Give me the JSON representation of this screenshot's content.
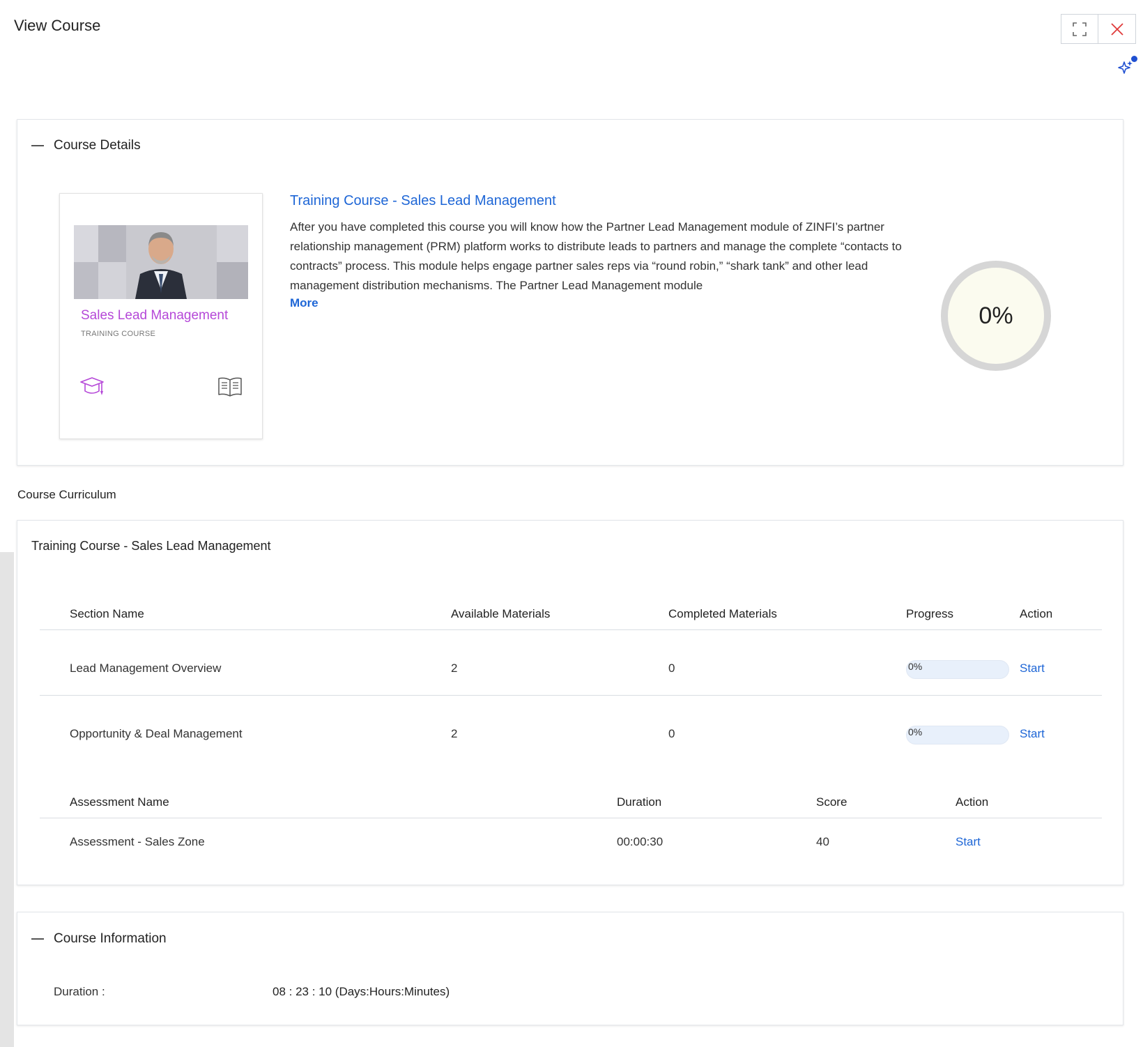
{
  "header": {
    "title": "View Course"
  },
  "window_controls": {
    "fullscreen_icon": "fullscreen-icon",
    "close_icon": "close-icon",
    "ai_icon": "sparkle-icon"
  },
  "course_details": {
    "section_title": "Course Details",
    "thumbnail": {
      "title": "Sales Lead Management",
      "subtitle": "TRAINING COURSE",
      "cap_icon": "graduation-cap-icon",
      "book_icon": "open-book-icon"
    },
    "title": "Training Course - Sales Lead Management",
    "description": "After you have completed this course you will know how the Partner Lead Management module of ZINFI’s partner relationship management (PRM) platform works to distribute leads to partners and manage the complete “contacts to contracts” process. This module helps engage partner sales reps via “round robin,” “shark tank” and other lead management distribution mechanisms. The Partner Lead Management module",
    "more_label": "More",
    "progress_percent": 0,
    "progress_label": "0%"
  },
  "curriculum": {
    "label": "Course Curriculum",
    "course_title": "Training Course - Sales Lead Management",
    "sections_headers": {
      "name": "Section Name",
      "available": "Available Materials",
      "completed": "Completed Materials",
      "progress": "Progress",
      "action": "Action"
    },
    "sections": [
      {
        "name": "Lead Management Overview",
        "available": "2",
        "completed": "0",
        "progress": 0,
        "progress_label": "0%",
        "action": "Start"
      },
      {
        "name": "Opportunity & Deal Management",
        "available": "2",
        "completed": "0",
        "progress": 0,
        "progress_label": "0%",
        "action": "Start"
      }
    ],
    "assessment_headers": {
      "name": "Assessment Name",
      "duration": "Duration",
      "score": "Score",
      "action": "Action"
    },
    "assessments": [
      {
        "name": "Assessment - Sales Zone",
        "duration": "00:00:30",
        "score": "40",
        "action": "Start"
      }
    ]
  },
  "course_information": {
    "section_title": "Course Information",
    "duration_label": "Duration :",
    "duration_value": "08 : 23 : 10 (Days:Hours:Minutes)"
  },
  "colors": {
    "link": "#1e66d6",
    "accent_purple": "#b548d8",
    "ring_gray": "#d6d6d6",
    "ring_fill": "#fbfbef",
    "close_red": "#e03a3a"
  }
}
